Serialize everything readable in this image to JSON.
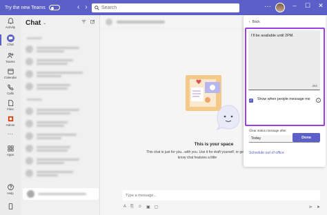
{
  "titlebar": {
    "new_teams_label": "Try the new Teams",
    "search_placeholder": "Search",
    "more_label": "···",
    "window_controls": {
      "minimize": "–",
      "maximize": "☐",
      "close": "✕"
    }
  },
  "rail": {
    "items": [
      {
        "label": "Activity",
        "icon": "bell-icon"
      },
      {
        "label": "Chat",
        "icon": "chat-icon",
        "active": true
      },
      {
        "label": "Teams",
        "icon": "teams-icon"
      },
      {
        "label": "Calendar",
        "icon": "calendar-icon"
      },
      {
        "label": "Calls",
        "icon": "phone-icon"
      },
      {
        "label": "Files",
        "icon": "file-icon"
      },
      {
        "label": "Admin",
        "icon": "office-icon"
      },
      {
        "label": "Apps",
        "icon": "apps-icon"
      },
      {
        "label": "Help",
        "icon": "help-icon"
      }
    ],
    "more_label": "···"
  },
  "chatlist": {
    "title": "Chat",
    "chevron": "⌄"
  },
  "main": {
    "empty_title": "This is your space",
    "empty_desc": "This chat is just for you...with you. Use it for draft yourself, or get to know chat features a little",
    "compose_placeholder": "Type a message..."
  },
  "popup": {
    "back_label": "Back",
    "message": "I'll be available until 2PM.",
    "char_count": "252",
    "show_when_label": "Show when people message me",
    "clear_after_label": "Clear status message after",
    "clear_after_value": "Today",
    "schedule_link": "Schedule out of office",
    "done_label": "Done"
  },
  "colors": {
    "accent": "#5b5fc7",
    "highlight": "#9b3ee6",
    "titlebar": "#5b5fc7"
  }
}
